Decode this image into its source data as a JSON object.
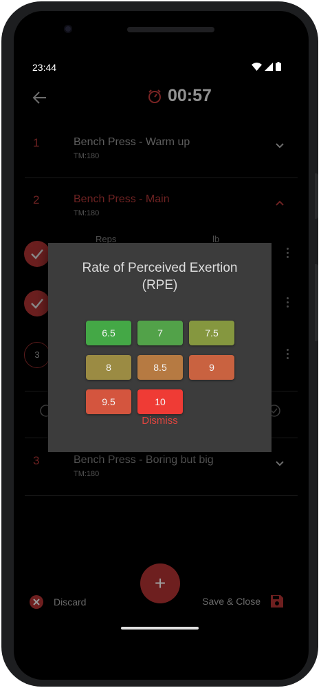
{
  "status": {
    "time": "23:44"
  },
  "appbar": {
    "timer": "00:57"
  },
  "exercises": [
    {
      "number": "1",
      "title": "Bench Press - Warm up",
      "subtitle": "TM:180"
    },
    {
      "number": "2",
      "title": "Bench Press - Main",
      "subtitle": "TM:180"
    },
    {
      "number": "3",
      "title": "Bench Press - Boring but big",
      "subtitle": "TM:180"
    }
  ],
  "set_table": {
    "reps_header": "Reps",
    "weight_header": "lb"
  },
  "sets": [
    {
      "state": "done"
    },
    {
      "state": "done"
    },
    {
      "state": "pending",
      "number": "3"
    }
  ],
  "dialog": {
    "title_line1": "Rate of Perceived Exertion",
    "title_line2": "(RPE)",
    "options": [
      {
        "label": "6.5",
        "color": "#44a846"
      },
      {
        "label": "7",
        "color": "#52a249"
      },
      {
        "label": "7.5",
        "color": "#85973f"
      },
      {
        "label": "8",
        "color": "#9b8b43"
      },
      {
        "label": "8.5",
        "color": "#b67a42"
      },
      {
        "label": "9",
        "color": "#c96240"
      },
      {
        "label": "9.5",
        "color": "#d4553e"
      },
      {
        "label": "10",
        "color": "#ef3b35"
      }
    ],
    "dismiss_label": "Dismiss"
  },
  "bottom": {
    "discard_label": "Discard",
    "save_label": "Save & Close"
  },
  "colors": {
    "accent": "#e0453f",
    "dim_accent": "#6e1f1f"
  }
}
